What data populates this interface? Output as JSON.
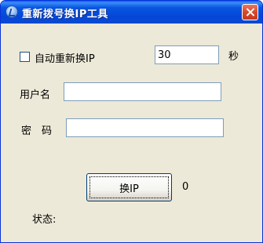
{
  "window": {
    "title": "重新拨号换IP工具",
    "colors": {
      "titlebar": "#0a55e0",
      "face": "#ece9d8",
      "close": "#d8482a"
    }
  },
  "auto_redial": {
    "label": "自动重新换IP",
    "checked": false,
    "interval_value": "30",
    "unit": "秒"
  },
  "username": {
    "label": "用户名",
    "value": ""
  },
  "password": {
    "label": "密　码",
    "value": ""
  },
  "action": {
    "button_label": "换IP",
    "count": "0"
  },
  "status": {
    "label": "状态:",
    "value": ""
  },
  "icons": {
    "app": "app-icon",
    "close": "close-icon"
  }
}
